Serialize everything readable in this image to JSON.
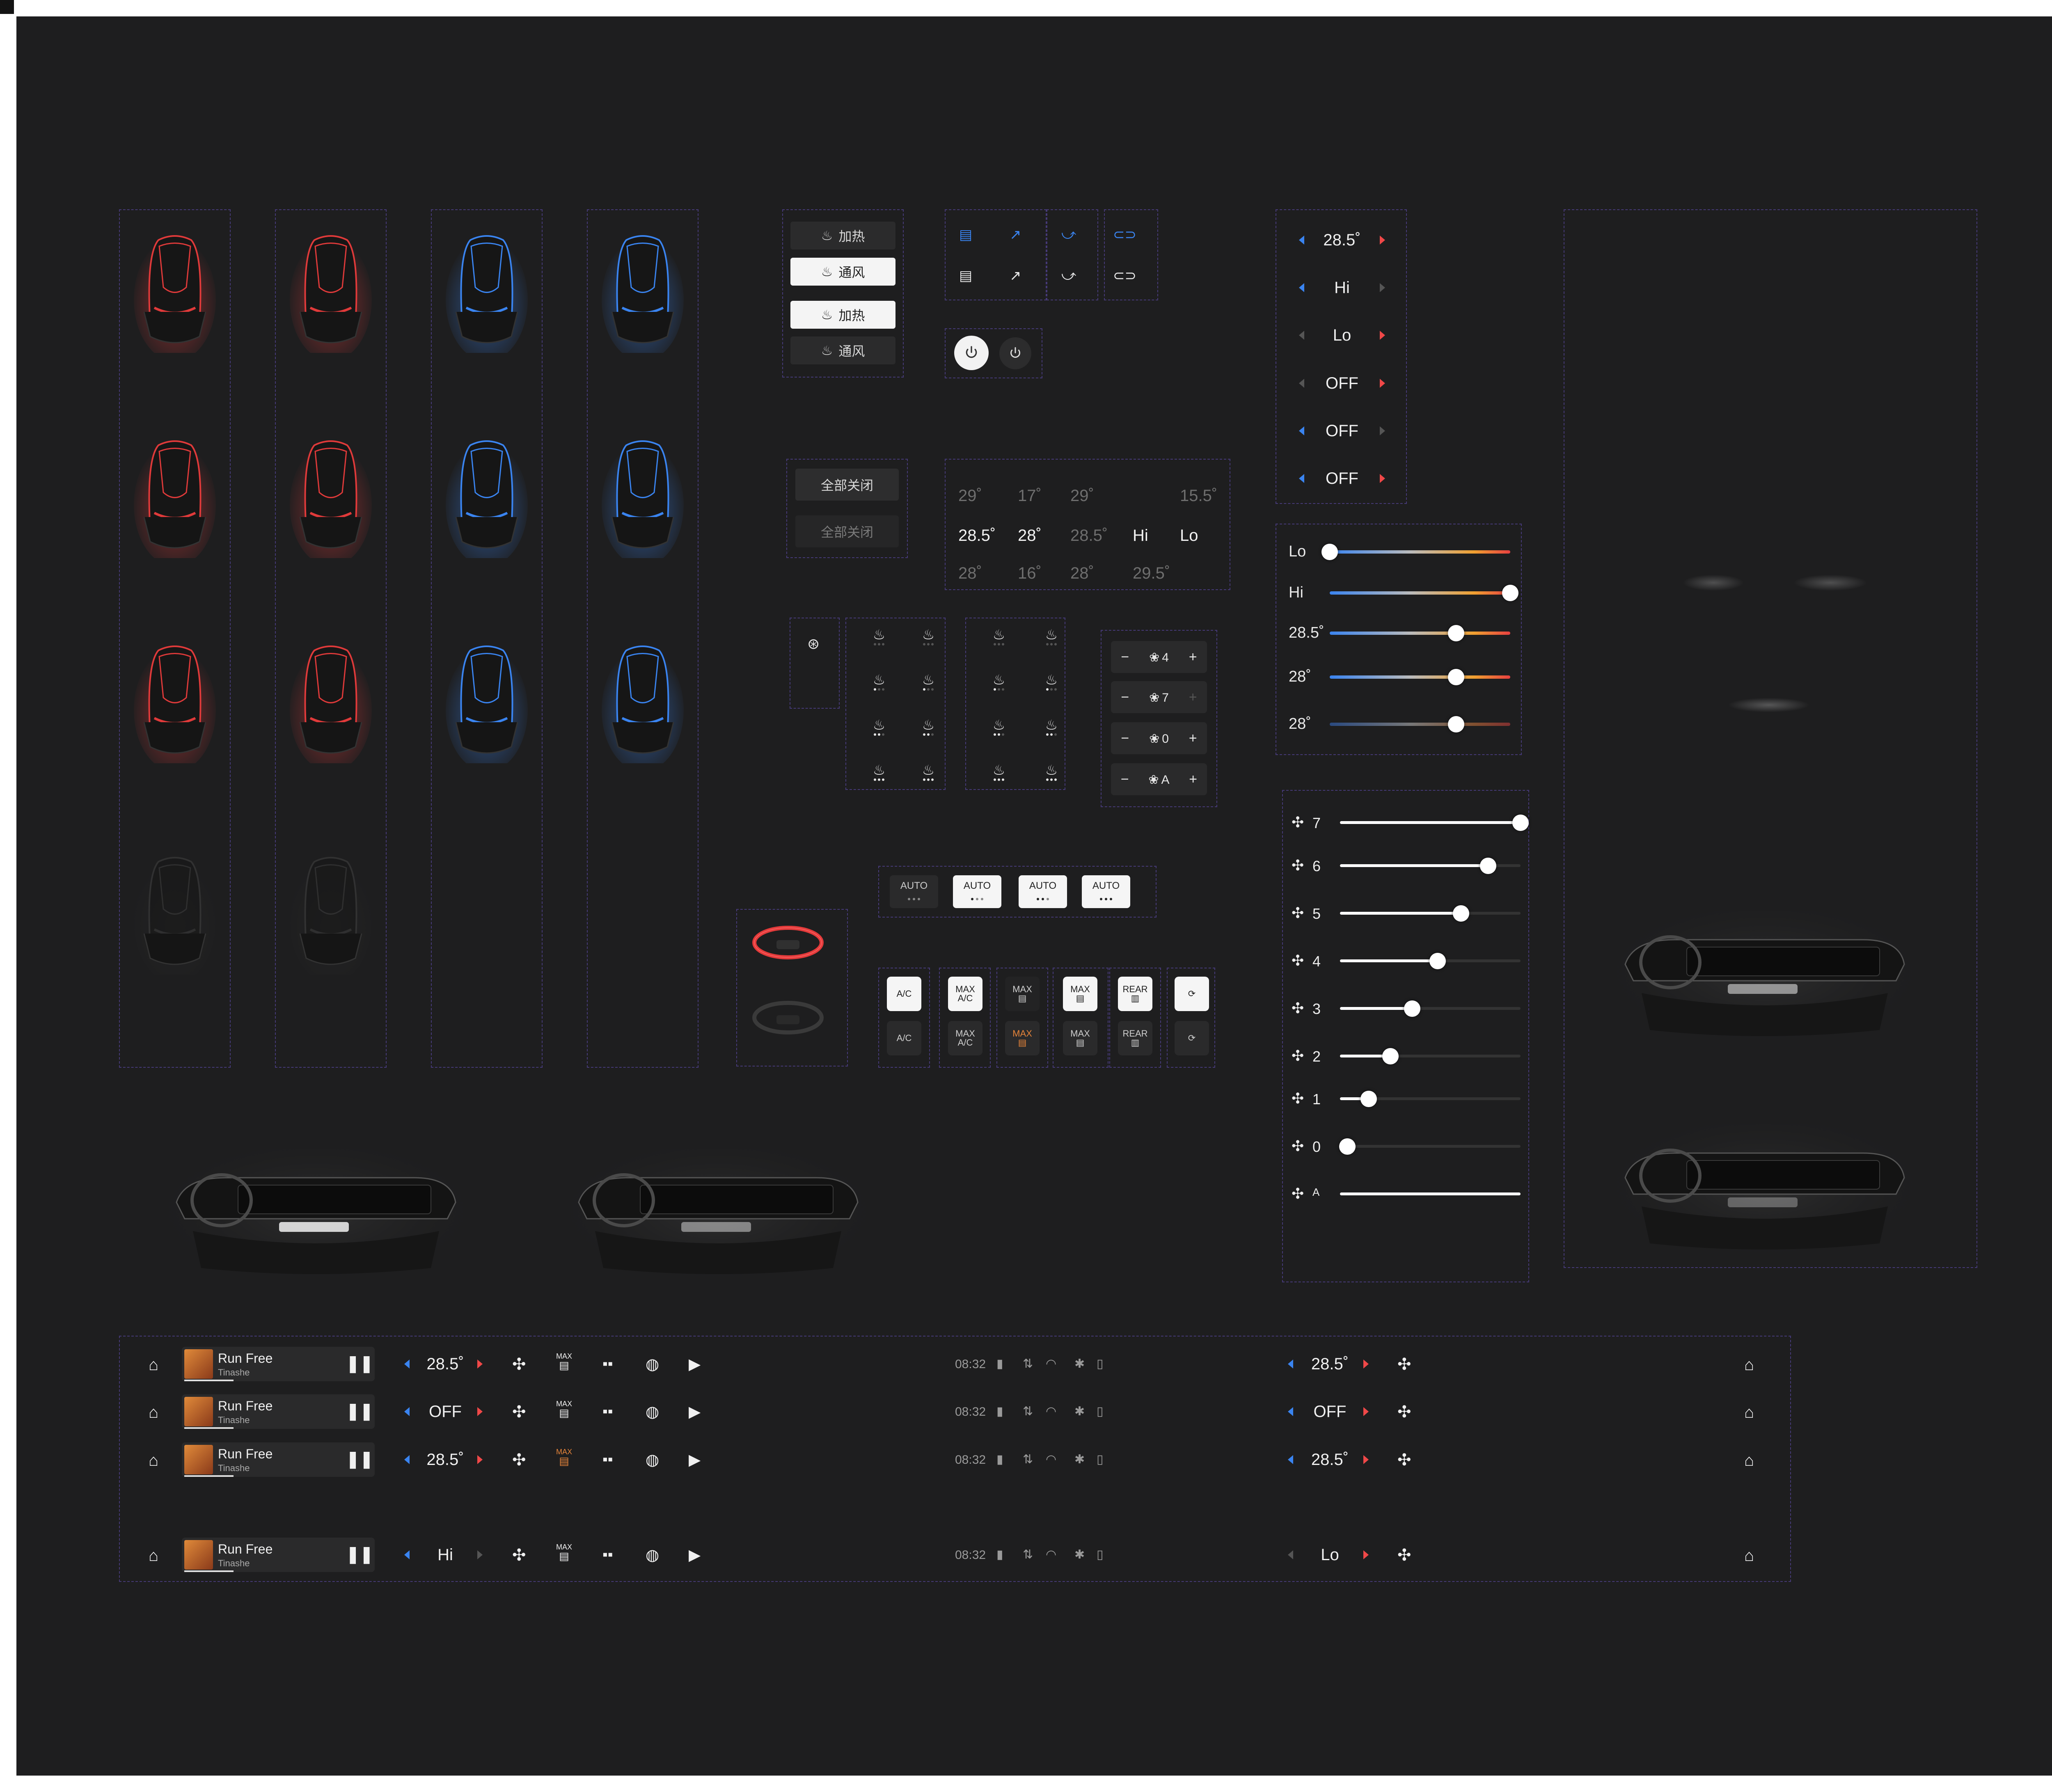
{
  "seat_panel": {
    "heat_label": "加热",
    "vent_label": "通风"
  },
  "close_all": {
    "label_active": "全部关闭",
    "label_disabled": "全部关闭"
  },
  "temp_grid": {
    "row1": [
      "29˚",
      "17˚",
      "29˚",
      "",
      "15.5˚"
    ],
    "row2": [
      "28.5˚",
      "28˚",
      "28.5˚",
      "Hi",
      "Lo"
    ],
    "row3": [
      "28˚",
      "16˚",
      "28˚",
      "29.5˚",
      ""
    ]
  },
  "temp_stepper": {
    "items": [
      "28.5˚",
      "Hi",
      "Lo",
      "OFF",
      "OFF",
      "OFF"
    ]
  },
  "temp_sliders": {
    "items": [
      {
        "label": "Lo",
        "level": 0.0
      },
      {
        "label": "Hi",
        "level": 1.0
      },
      {
        "label": "28.5˚",
        "level": 0.7
      },
      {
        "label": "28˚",
        "level": 0.7
      },
      {
        "label": "28˚",
        "level": 0.7
      }
    ]
  },
  "fan_steppers": {
    "items": [
      "4",
      "7",
      "0",
      "A"
    ]
  },
  "fan_sliders": {
    "items": [
      {
        "label": "7",
        "level": 1.0
      },
      {
        "label": "6",
        "level": 0.82
      },
      {
        "label": "5",
        "level": 0.67
      },
      {
        "label": "4",
        "level": 0.54
      },
      {
        "label": "3",
        "level": 0.4
      },
      {
        "label": "2",
        "level": 0.28
      },
      {
        "label": "1",
        "level": 0.16
      },
      {
        "label": "0",
        "level": 0.04
      },
      {
        "label": "A",
        "level": 1.0
      }
    ]
  },
  "auto_buttons": {
    "label": "AUTO"
  },
  "ac_buttons": {
    "ac": "A/C",
    "max_ac_top": "MAX",
    "max_ac_bottom": "A/C",
    "max": "MAX",
    "rear": "REAR"
  },
  "bottom_bar": {
    "rows": [
      {
        "song": "Run Free",
        "artist": "Tinashe",
        "left_temp": "28.5˚",
        "time": "08:32",
        "right_temp": "28.5˚",
        "max_highlight": false
      },
      {
        "song": "Run Free",
        "artist": "Tinashe",
        "left_temp": "OFF",
        "time": "08:32",
        "right_temp": "OFF",
        "max_highlight": false
      },
      {
        "song": "Run Free",
        "artist": "Tinashe",
        "left_temp": "28.5˚",
        "time": "08:32",
        "right_temp": "28.5˚",
        "max_highlight": true
      },
      {
        "song": "Run Free",
        "artist": "Tinashe",
        "left_temp": "Hi",
        "time": "08:32",
        "right_temp": "Lo",
        "max_highlight": false
      }
    ]
  },
  "colors": {
    "background": "#1e1e1f",
    "heat_red": "#e03a3a",
    "cool_blue": "#3a84f0",
    "frame_dash": "#463a78",
    "max_orange": "#e6843a"
  }
}
